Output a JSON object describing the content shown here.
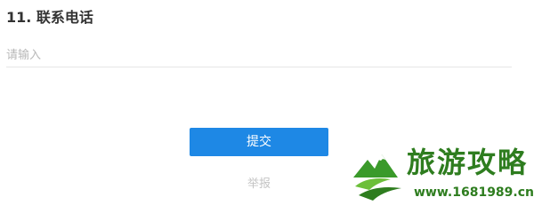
{
  "question": {
    "title": "11. 联系电话",
    "input_placeholder": "请输入",
    "input_value": ""
  },
  "actions": {
    "submit_label": "提交",
    "report_label": "举报"
  },
  "watermark": {
    "title": "旅游攻略",
    "url": "www.1681989.cn"
  },
  "colors": {
    "primary": "#1e88e5",
    "watermark_green": "#2e7d1f"
  }
}
